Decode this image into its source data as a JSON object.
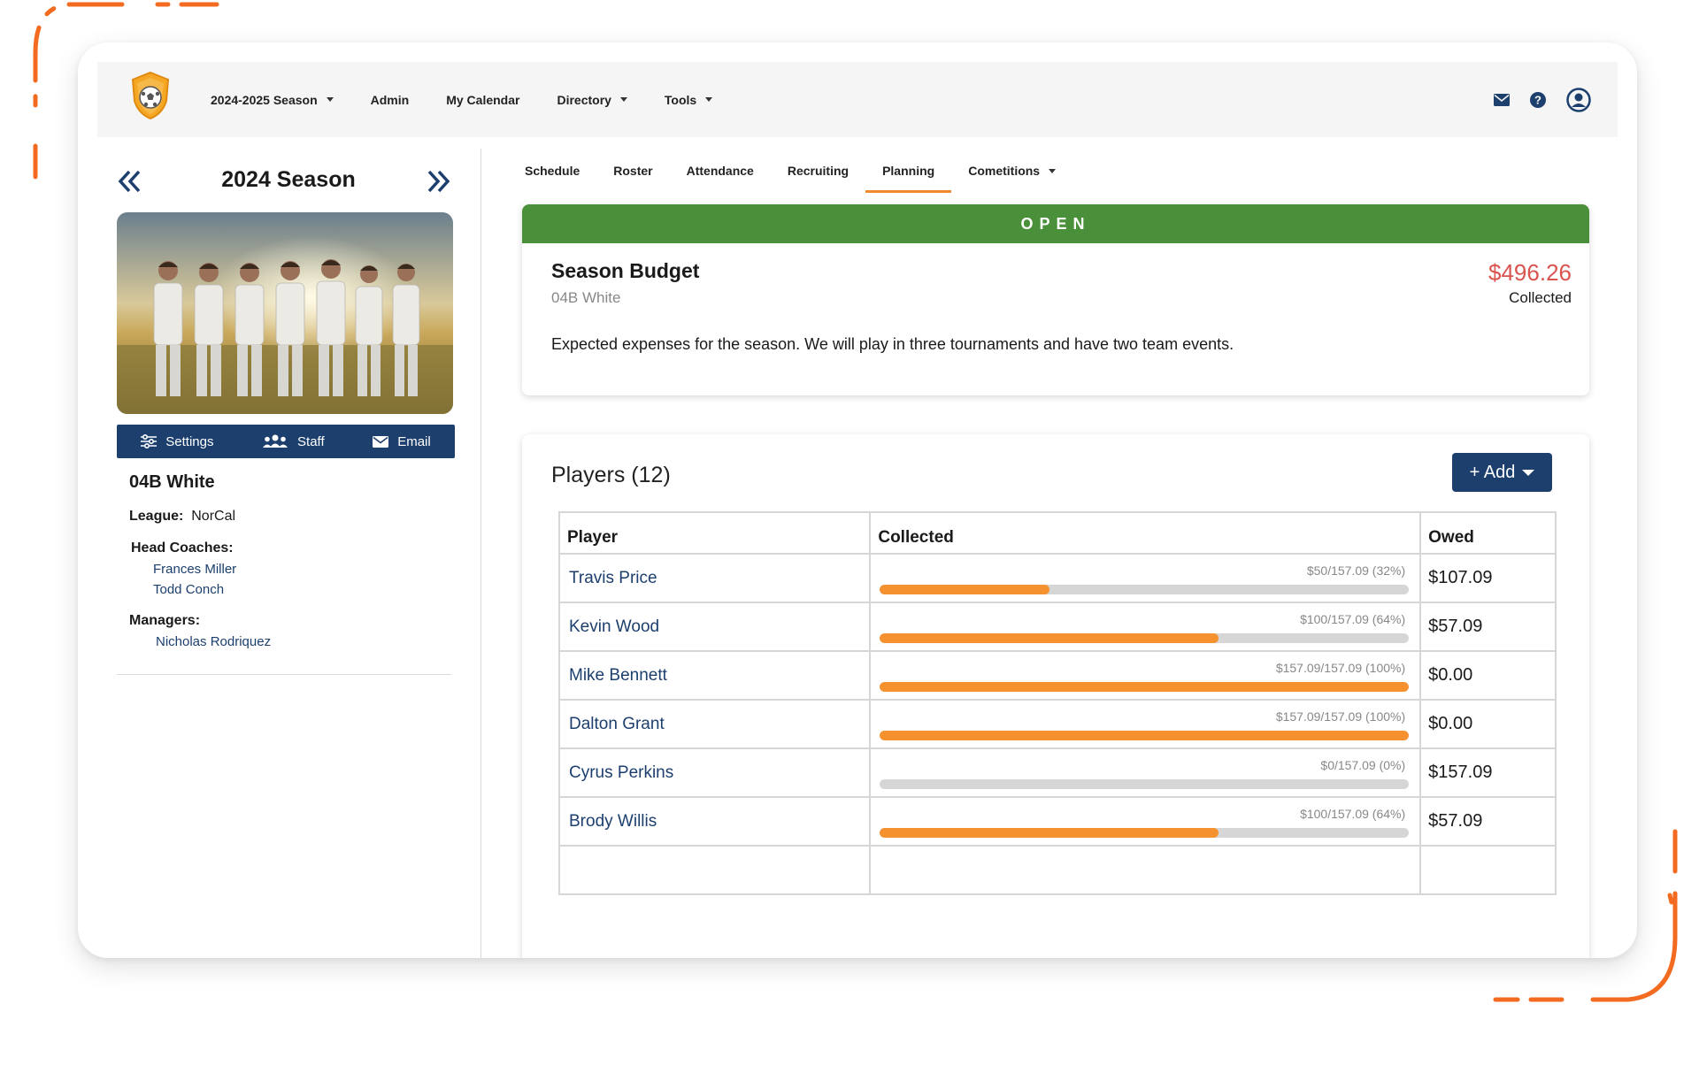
{
  "navbar": {
    "items": [
      {
        "label": "2024-2025 Season",
        "dropdown": true
      },
      {
        "label": "Admin",
        "dropdown": false
      },
      {
        "label": "My Calendar",
        "dropdown": false
      },
      {
        "label": "Directory",
        "dropdown": true
      },
      {
        "label": "Tools",
        "dropdown": true
      }
    ],
    "icons": [
      "mail-icon",
      "help-icon",
      "user-account-icon"
    ]
  },
  "sidebar": {
    "season_title": "2024 Season",
    "actions": {
      "settings": "Settings",
      "staff": "Staff",
      "email": "Email"
    },
    "team_name": "04B White",
    "league_label": "League:",
    "league_value": "NorCal",
    "head_coaches_label": "Head Coaches:",
    "head_coaches": [
      "Frances Miller",
      "Todd Conch"
    ],
    "managers_label": "Managers:",
    "managers": [
      "Nicholas Rodriquez"
    ]
  },
  "tabs": [
    {
      "label": "Schedule",
      "active": false
    },
    {
      "label": "Roster",
      "active": false
    },
    {
      "label": "Attendance",
      "active": false
    },
    {
      "label": "Recruiting",
      "active": false
    },
    {
      "label": "Planning",
      "active": true
    },
    {
      "label": "Cometitions",
      "active": false,
      "dropdown": true
    }
  ],
  "budget": {
    "status": "OPEN",
    "title": "Season Budget",
    "team": "04B White",
    "amount": "$496.26",
    "amount_label": "Collected",
    "description": "Expected expenses for the season. We will play in three tournaments and have two team events."
  },
  "players": {
    "title": "Players (12)",
    "add_label": "+ Add",
    "columns": [
      "Player",
      "Collected",
      "Owed"
    ],
    "rows": [
      {
        "name": "Travis Price",
        "collected_text": "$50/157.09 (32%)",
        "collected_pct": 32,
        "owed": "$107.09"
      },
      {
        "name": "Kevin Wood",
        "collected_text": "$100/157.09 (64%)",
        "collected_pct": 64,
        "owed": "$57.09"
      },
      {
        "name": "Mike Bennett",
        "collected_text": "$157.09/157.09 (100%)",
        "collected_pct": 100,
        "owed": "$0.00"
      },
      {
        "name": "Dalton Grant",
        "collected_text": "$157.09/157.09 (100%)",
        "collected_pct": 100,
        "owed": "$0.00"
      },
      {
        "name": "Cyrus Perkins",
        "collected_text": "$0/157.09 (0%)",
        "collected_pct": 0,
        "owed": "$157.09"
      },
      {
        "name": "Brody Willis",
        "collected_text": "$100/157.09 (64%)",
        "collected_pct": 64,
        "owed": "$57.09"
      }
    ]
  },
  "colors": {
    "accent_orange": "#f5922f",
    "navy": "#1c3f6e",
    "open_green": "#4a8f3a",
    "amount_red": "#d9534f"
  }
}
